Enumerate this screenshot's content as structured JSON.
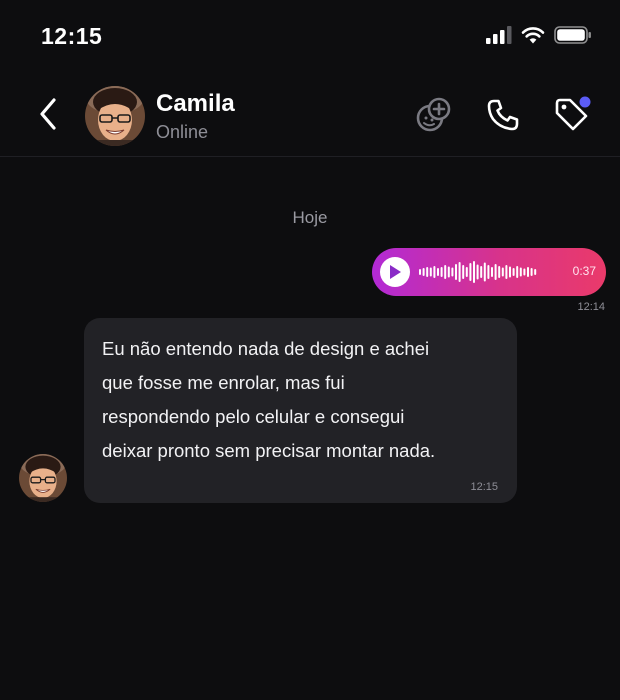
{
  "status_bar": {
    "time": "12:15",
    "icons": [
      "cellular-signal-icon",
      "wifi-icon",
      "battery-icon"
    ]
  },
  "header": {
    "contact_name": "Camila",
    "contact_status": "Online",
    "actions": [
      "emoji-add-icon",
      "phone-icon",
      "tag-icon"
    ],
    "tag_badge_color": "#5b5cf6"
  },
  "date_divider": "Hoje",
  "messages": [
    {
      "type": "voice",
      "direction": "outgoing",
      "duration": "0:37",
      "time": "12:14",
      "gradient": [
        "#b22ad6",
        "#ea3a6a"
      ]
    },
    {
      "type": "text",
      "direction": "incoming",
      "lines": [
        "Eu não entendo nada de design e achei",
        "que fosse me enrolar, mas fui",
        "respondendo pelo celular e consegui",
        "deixar pronto sem precisar montar nada."
      ],
      "time": "12:15"
    }
  ],
  "colors": {
    "background": "#0d0d0f",
    "bubble_incoming": "#222226",
    "muted_text": "#8e8e96"
  }
}
